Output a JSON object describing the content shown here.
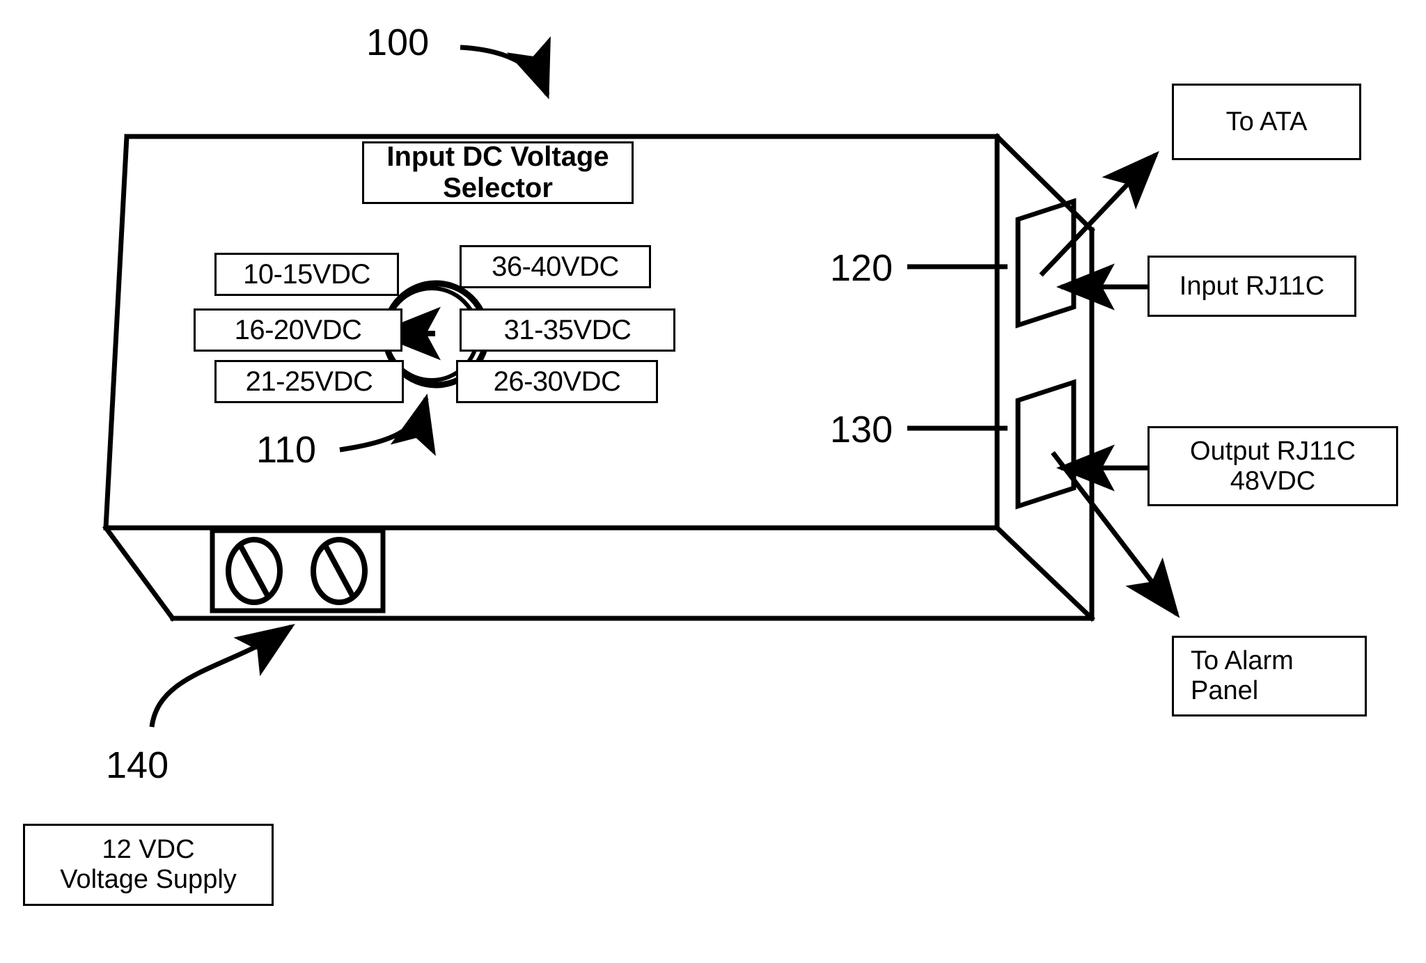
{
  "figure": {
    "type": "patent-diagram",
    "description": "Perspective view of a DC voltage converter enclosure with input DC voltage selector dial, RJ11C ports and screw terminal block"
  },
  "reference_numerals": [
    {
      "id": "ref-100",
      "label": "100",
      "points_to": "device-enclosure"
    },
    {
      "id": "ref-110",
      "label": "110",
      "points_to": "voltage-selector-dial"
    },
    {
      "id": "ref-120",
      "label": "120",
      "points_to": "input-rj11c-port"
    },
    {
      "id": "ref-130",
      "label": "130",
      "points_to": "output-rj11c-port"
    },
    {
      "id": "ref-140",
      "label": "140",
      "points_to": "screw-terminal-block"
    }
  ],
  "selector": {
    "title_line1": "Input DC Voltage",
    "title_line2": "Selector",
    "options": [
      {
        "key": "opt-10-15",
        "label": "10-15VDC"
      },
      {
        "key": "opt-36-40",
        "label": "36-40VDC"
      },
      {
        "key": "opt-16-20",
        "label": "16-20VDC"
      },
      {
        "key": "opt-31-35",
        "label": "31-35VDC"
      },
      {
        "key": "opt-21-25",
        "label": "21-25VDC"
      },
      {
        "key": "opt-26-30",
        "label": "26-30VDC"
      }
    ],
    "selected": "16-20VDC"
  },
  "callouts": {
    "to_ata": "To ATA",
    "input_rj11c": "Input RJ11C",
    "output_rj11c_line1": "Output RJ11C",
    "output_rj11c_line2": "48VDC",
    "to_alarm_line1": "To Alarm",
    "to_alarm_line2": "Panel",
    "supply_line1": "12 VDC",
    "supply_line2": "Voltage Supply"
  },
  "colors": {
    "ink": "#000000",
    "paper": "#ffffff"
  }
}
